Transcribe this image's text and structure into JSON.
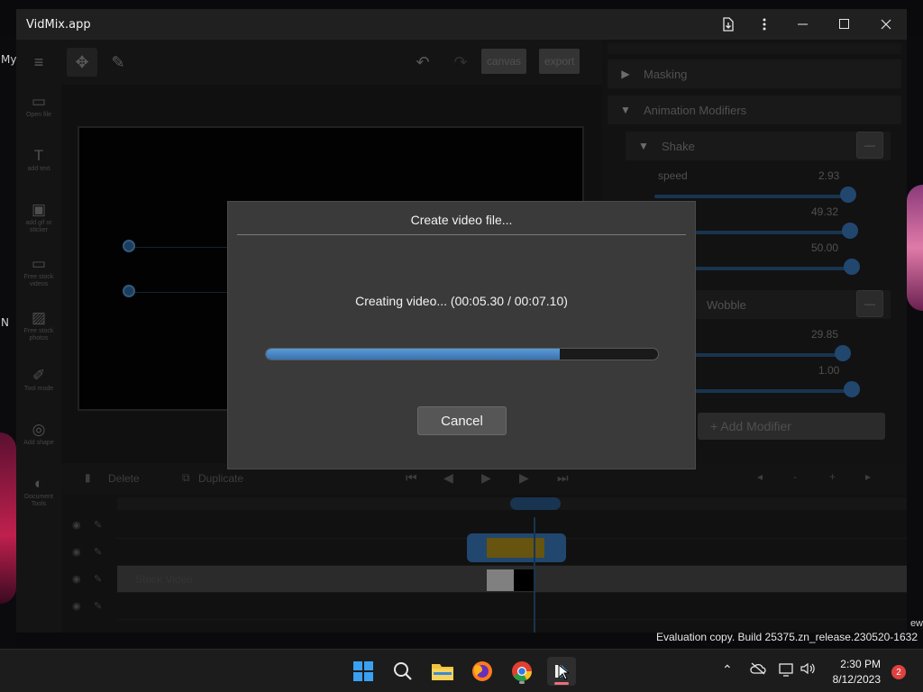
{
  "desktop": {
    "left_texts": [
      "My",
      "N"
    ],
    "right_text": "ew"
  },
  "window": {
    "title": "VidMix.app",
    "controls": [
      "minimize",
      "maximize",
      "close"
    ]
  },
  "toolbar": {
    "canvas_label": "canvas",
    "export_label": "export"
  },
  "sidebar": {
    "items": [
      {
        "label": "Open file",
        "icon": "folder-icon"
      },
      {
        "label": "add text",
        "icon": "text-icon"
      },
      {
        "label": "add gif or sticker",
        "icon": "sticker-icon"
      },
      {
        "label": "Free stock videos",
        "icon": "video-icon"
      },
      {
        "label": "Free stock photos",
        "icon": "image-icon"
      },
      {
        "label": "Tool mode",
        "icon": "brush-icon"
      },
      {
        "label": "Add shape",
        "icon": "shape-icon"
      },
      {
        "label": "Document Tools",
        "icon": "document-icon"
      }
    ]
  },
  "right_panel": {
    "sections": [
      "Masking",
      "Animation Modifiers"
    ],
    "shake": {
      "title": "Shake",
      "params": [
        {
          "label": "speed",
          "value": "2.93",
          "level": 0.93
        },
        {
          "label": "",
          "value": "49.32",
          "level": 0.9
        },
        {
          "label": "",
          "value": "50.00",
          "level": 0.95
        }
      ]
    },
    "wobble": {
      "title": "Wobble",
      "params": [
        {
          "label": "",
          "value": "29.85",
          "level": 0.85
        },
        {
          "label": "",
          "value": "1.00",
          "level": 0.95
        }
      ]
    },
    "add_modifier": "+ Add Modifier"
  },
  "timeline": {
    "delete_label": "Delete",
    "duplicate_label": "Duplicate",
    "track_text": "Stock Video"
  },
  "dialog": {
    "title": "Create video file...",
    "status": "Creating video... (00:05.30 / 00:07.10)",
    "progress": 0.75,
    "cancel_label": "Cancel"
  },
  "watermark": "Evaluation copy. Build 25375.zn_release.230520-1632",
  "taskbar": {
    "apps": [
      "start-icon",
      "search-icon",
      "file-explorer-icon",
      "firefox-icon",
      "chrome-icon",
      "vidmix-icon"
    ],
    "time": "2:30 PM",
    "date": "8/12/2023",
    "notification_count": "2"
  }
}
